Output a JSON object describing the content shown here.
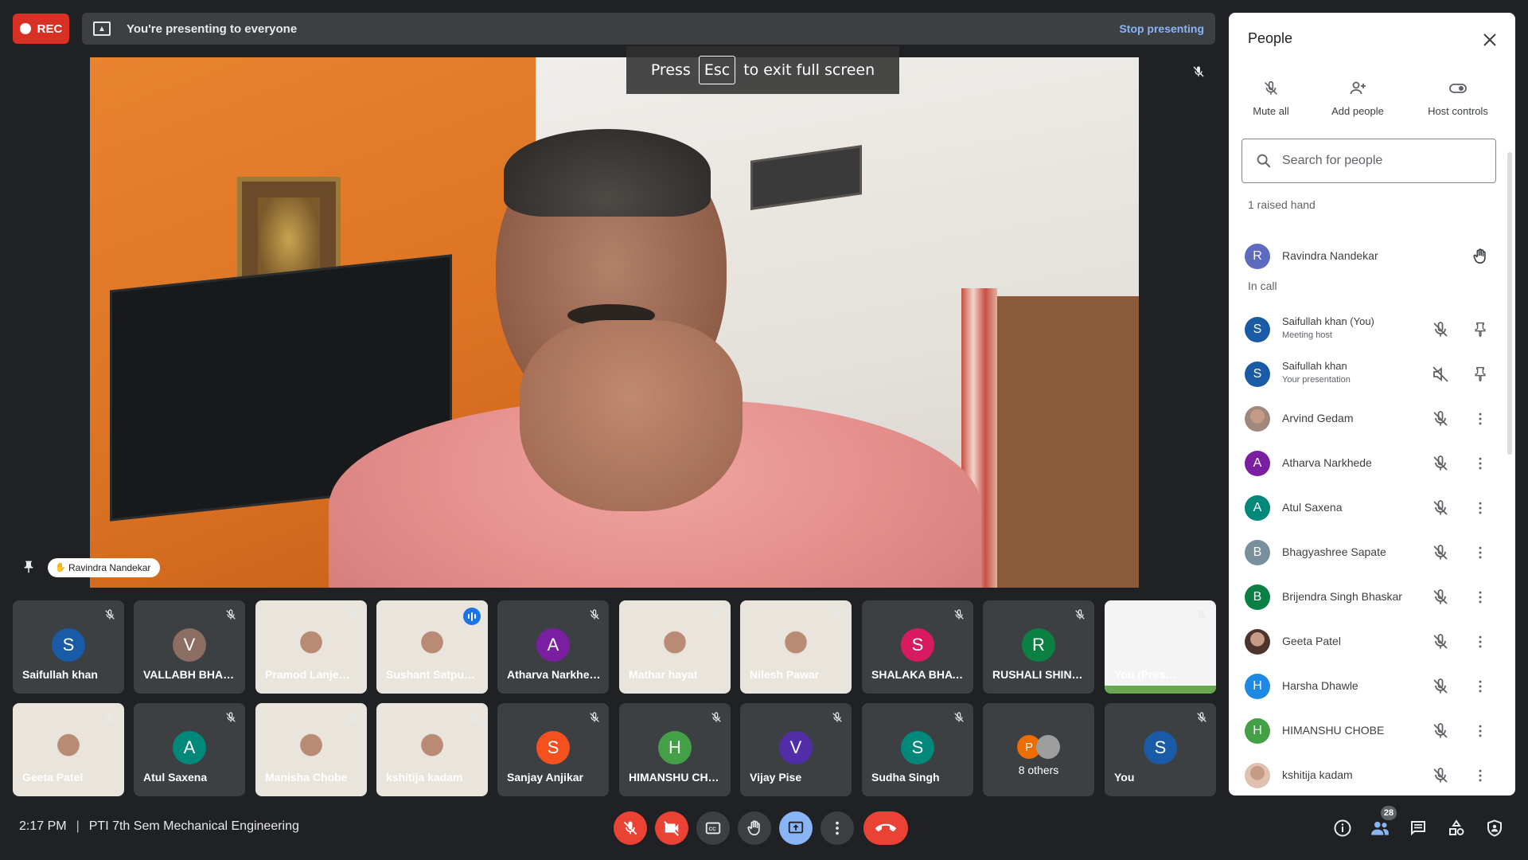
{
  "recording": {
    "label": "REC"
  },
  "presenting_bar": {
    "text": "You're presenting to everyone",
    "stop_label": "Stop presenting"
  },
  "fullscreen_banner": {
    "pre": "Press",
    "key": "Esc",
    "post": "to exit full screen"
  },
  "main_video": {
    "speaker_name": "Ravindra Nandekar"
  },
  "tiles_row1": [
    {
      "name": "Saifullah khan",
      "initial": "S",
      "color": "#1a5ba8"
    },
    {
      "name": "VALLABH BHAL…",
      "initial": "V",
      "color": "#8d6e63"
    },
    {
      "name": "Pramod Lanje…",
      "photo": true
    },
    {
      "name": "Sushant Satpu…",
      "photo": true,
      "speaking": true
    },
    {
      "name": "Atharva Narkhe…",
      "initial": "A",
      "color": "#7b1fa2"
    },
    {
      "name": "Mathar hayat",
      "photo": true
    },
    {
      "name": "Nilesh Pawar",
      "photo": true
    },
    {
      "name": "SHALAKA BHAVE",
      "initial": "S",
      "color": "#d81b60"
    },
    {
      "name": "RUSHALI SHIN…",
      "initial": "R",
      "color": "#0b8043"
    },
    {
      "name": "You (Pres…",
      "presentation": true
    }
  ],
  "tiles_row2": [
    {
      "name": "Geeta Patel",
      "photo": true
    },
    {
      "name": "Atul Saxena",
      "initial": "A",
      "color": "#00897b"
    },
    {
      "name": "Manisha Chobe",
      "photo": true
    },
    {
      "name": "kshitija kadam",
      "photo": true
    },
    {
      "name": "Sanjay Anjikar",
      "initial": "S",
      "color": "#f4511e"
    },
    {
      "name": "HIMANSHU CH…",
      "initial": "H",
      "color": "#43a047"
    },
    {
      "name": "Vijay Pise",
      "initial": "V",
      "color": "#512da8"
    },
    {
      "name": "Sudha Singh",
      "initial": "S",
      "color": "#00897b"
    },
    {
      "name": "8 others",
      "others": true,
      "initial": "P"
    },
    {
      "name": "You",
      "initial": "S",
      "color": "#1a5ba8"
    }
  ],
  "bottom": {
    "time": "2:17 PM",
    "meeting_title": "PTI 7th Sem Mechanical Engineering",
    "people_count": "28"
  },
  "people_panel": {
    "title": "People",
    "actions": [
      {
        "label": "Mute all",
        "icon": "mic-off-icon"
      },
      {
        "label": "Add people",
        "icon": "add-person-icon"
      },
      {
        "label": "Host controls",
        "icon": "toggle-icon"
      }
    ],
    "search_placeholder": "Search for people",
    "raised_hand_section": "1 raised hand",
    "raised": [
      {
        "name": "Ravindra Nandekar",
        "initial": "R",
        "color": "#5c6bc0"
      }
    ],
    "in_call_section": "In call",
    "in_call": [
      {
        "name": "Saifullah khan (You)",
        "sub": "Meeting host",
        "initial": "S",
        "color": "#1a5ba8",
        "action": "pin"
      },
      {
        "name": "Saifullah khan",
        "sub": "Your presentation",
        "initial": "S",
        "color": "#1a5ba8",
        "action": "pin",
        "vol_off": true
      },
      {
        "name": "Arvind Gedam",
        "photo": true,
        "color": "#a1887f",
        "action": "more"
      },
      {
        "name": "Atharva Narkhede",
        "initial": "A",
        "color": "#7b1fa2",
        "action": "more"
      },
      {
        "name": "Atul Saxena",
        "initial": "A",
        "color": "#00897b",
        "action": "more"
      },
      {
        "name": "Bhagyashree Sapate",
        "initial": "B",
        "color": "#78909c",
        "action": "more"
      },
      {
        "name": "Brijendra Singh Bhaskar",
        "initial": "B",
        "color": "#0b8043",
        "action": "more"
      },
      {
        "name": "Geeta Patel",
        "photo": true,
        "color": "#4e342e",
        "action": "more"
      },
      {
        "name": "Harsha Dhawle",
        "initial": "H",
        "color": "#1e88e5",
        "action": "more"
      },
      {
        "name": "HIMANSHU CHOBE",
        "initial": "H",
        "color": "#43a047",
        "action": "more"
      },
      {
        "name": "kshitija kadam",
        "photo": true,
        "color": "#e0c0b0",
        "action": "more"
      }
    ]
  }
}
